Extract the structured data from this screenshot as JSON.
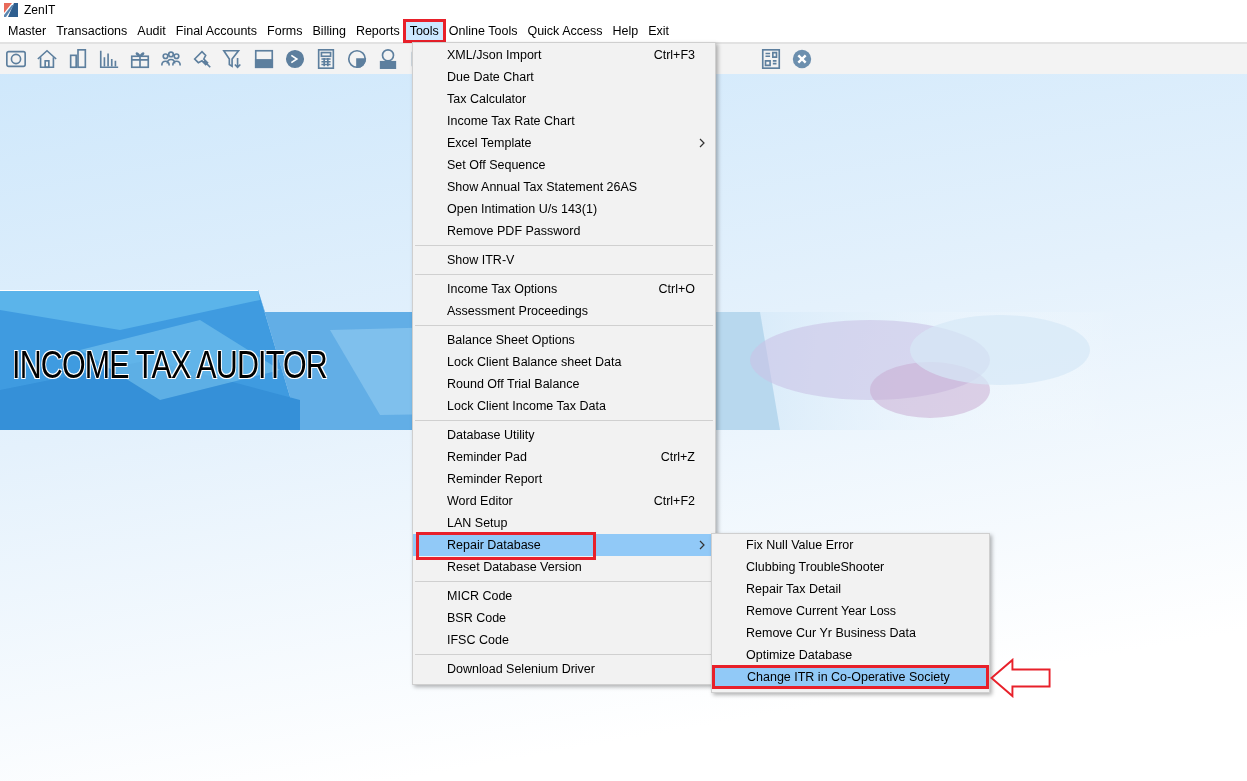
{
  "window": {
    "title": "ZenIT"
  },
  "menu_bar": [
    {
      "label": "Master",
      "selected": false,
      "annotated": false
    },
    {
      "label": "Transactions",
      "selected": false,
      "annotated": false
    },
    {
      "label": "Audit",
      "selected": false,
      "annotated": false
    },
    {
      "label": "Final Accounts",
      "selected": false,
      "annotated": false
    },
    {
      "label": "Forms",
      "selected": false,
      "annotated": false
    },
    {
      "label": "Billing",
      "selected": false,
      "annotated": false
    },
    {
      "label": "Reports",
      "selected": false,
      "annotated": false
    },
    {
      "label": "Tools",
      "selected": true,
      "annotated": true
    },
    {
      "label": "Online Tools",
      "selected": false,
      "annotated": false
    },
    {
      "label": "Quick Access",
      "selected": false,
      "annotated": false
    },
    {
      "label": "Help",
      "selected": false,
      "annotated": false
    },
    {
      "label": "Exit",
      "selected": false,
      "annotated": false
    }
  ],
  "banner": {
    "title": "INCOME TAX AUDITOR"
  },
  "tools_menu": [
    {
      "kind": "item",
      "label": "XML/Json Import",
      "shortcut": "Ctrl+F3",
      "selected": false,
      "annotated": false,
      "submenu": false
    },
    {
      "kind": "item",
      "label": "Due Date Chart",
      "selected": false,
      "annotated": false,
      "submenu": false
    },
    {
      "kind": "item",
      "label": "Tax Calculator",
      "selected": false,
      "annotated": false,
      "submenu": false
    },
    {
      "kind": "item",
      "label": "Income Tax Rate Chart",
      "selected": false,
      "annotated": false,
      "submenu": false
    },
    {
      "kind": "item",
      "label": "Excel Template",
      "selected": false,
      "annotated": false,
      "submenu": true
    },
    {
      "kind": "item",
      "label": "Set Off Sequence",
      "selected": false,
      "annotated": false,
      "submenu": false
    },
    {
      "kind": "item",
      "label": "Show Annual Tax Statement 26AS",
      "selected": false,
      "annotated": false,
      "submenu": false
    },
    {
      "kind": "item",
      "label": "Open Intimation U/s 143(1)",
      "selected": false,
      "annotated": false,
      "submenu": false
    },
    {
      "kind": "item",
      "label": "Remove PDF Password",
      "selected": false,
      "annotated": false,
      "submenu": false
    },
    {
      "kind": "separator"
    },
    {
      "kind": "item",
      "label": "Show ITR-V",
      "selected": false,
      "annotated": false,
      "submenu": false
    },
    {
      "kind": "separator"
    },
    {
      "kind": "item",
      "label": "Income Tax Options",
      "shortcut": "Ctrl+O",
      "selected": false,
      "annotated": false,
      "submenu": false
    },
    {
      "kind": "item",
      "label": "Assessment Proceedings",
      "selected": false,
      "annotated": false,
      "submenu": false
    },
    {
      "kind": "separator"
    },
    {
      "kind": "item",
      "label": "Balance Sheet Options",
      "selected": false,
      "annotated": false,
      "submenu": false
    },
    {
      "kind": "item",
      "label": "Lock Client Balance sheet Data",
      "selected": false,
      "annotated": false,
      "submenu": false
    },
    {
      "kind": "item",
      "label": "Round Off Trial Balance",
      "selected": false,
      "annotated": false,
      "submenu": false
    },
    {
      "kind": "item",
      "label": "Lock Client Income Tax Data",
      "selected": false,
      "annotated": false,
      "submenu": false
    },
    {
      "kind": "separator"
    },
    {
      "kind": "item",
      "label": "Database Utility",
      "selected": false,
      "annotated": false,
      "submenu": false
    },
    {
      "kind": "item",
      "label": "Reminder Pad",
      "shortcut": "Ctrl+Z",
      "selected": false,
      "annotated": false,
      "submenu": false
    },
    {
      "kind": "item",
      "label": "Reminder Report",
      "selected": false,
      "annotated": false,
      "submenu": false
    },
    {
      "kind": "item",
      "label": "Word Editor",
      "shortcut": "Ctrl+F2",
      "selected": false,
      "annotated": false,
      "submenu": false
    },
    {
      "kind": "item",
      "label": "LAN Setup",
      "selected": false,
      "annotated": false,
      "submenu": false
    },
    {
      "kind": "item",
      "label": "Repair Database",
      "selected": true,
      "annotated": true,
      "submenu": true
    },
    {
      "kind": "item",
      "label": "Reset Database Version",
      "selected": false,
      "annotated": false,
      "submenu": false
    },
    {
      "kind": "separator"
    },
    {
      "kind": "item",
      "label": "MICR Code",
      "selected": false,
      "annotated": false,
      "submenu": false
    },
    {
      "kind": "item",
      "label": "BSR Code",
      "selected": false,
      "annotated": false,
      "submenu": false
    },
    {
      "kind": "item",
      "label": "IFSC Code",
      "selected": false,
      "annotated": false,
      "submenu": false
    },
    {
      "kind": "separator"
    },
    {
      "kind": "item",
      "label": "Download Selenium Driver",
      "selected": false,
      "annotated": false,
      "submenu": false
    }
  ],
  "repair_submenu": [
    {
      "label": "Fix Null Value Error",
      "selected": false,
      "annotated": false
    },
    {
      "label": "Clubbing TroubleShooter",
      "selected": false,
      "annotated": false
    },
    {
      "label": "Repair Tax Detail",
      "selected": false,
      "annotated": false
    },
    {
      "label": "Remove Current Year Loss",
      "selected": false,
      "annotated": false
    },
    {
      "label": "Remove Cur Yr Business Data",
      "selected": false,
      "annotated": false
    },
    {
      "label": "Optimize Database",
      "selected": false,
      "annotated": false
    },
    {
      "label": "Change ITR in Co-Operative Society",
      "selected": true,
      "annotated": true
    }
  ]
}
